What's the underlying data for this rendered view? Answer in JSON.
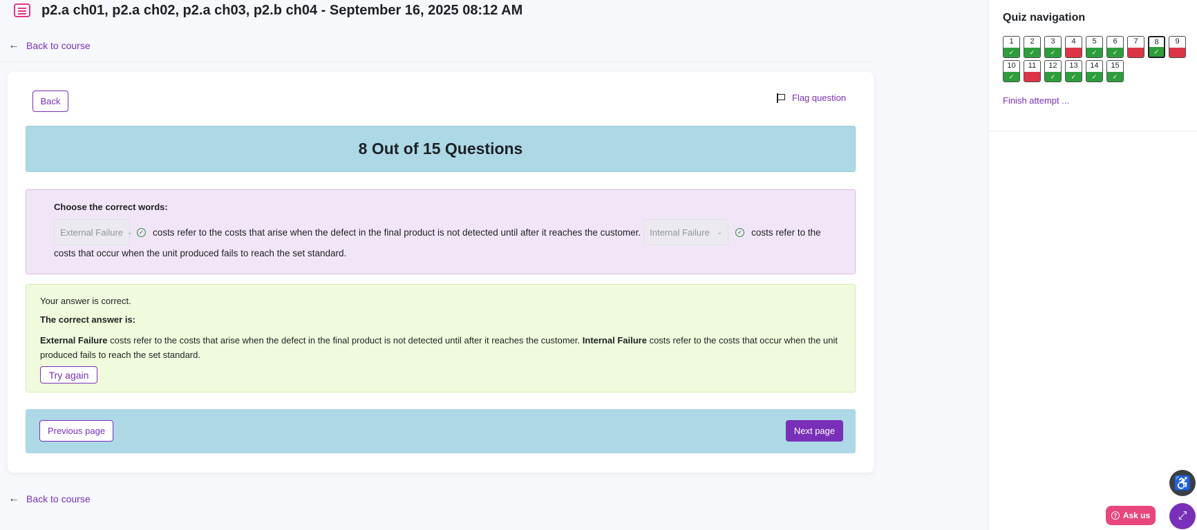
{
  "header": {
    "title": "p2.a ch01, p2.a ch02, p2.a ch03, p2.b ch04 - September 16, 2025 08:12 AM",
    "back_to_course": "Back to course"
  },
  "question": {
    "back_label": "Back",
    "flag_label": "Flag question",
    "progress_title": "8 Out of 15 Questions",
    "prompt": "Choose the correct words:",
    "dropdown1_value": "External Failure",
    "text_after_dropdown1": "costs refer to the costs that arise when the defect in the final product is not detected until after it reaches the customer.",
    "dropdown2_value": "Internal Failure",
    "text_after_dropdown2": "costs refer to the",
    "text_line2": "costs that occur when the unit produced fails to reach the set standard."
  },
  "feedback": {
    "status": "Your answer is correct.",
    "correct_heading": "The correct answer is:",
    "answer_term1": "External Failure",
    "answer_text1": " costs refer to the costs that arise when the defect in the final product is not detected until after it reaches the customer. ",
    "answer_term2": "Internal Failure",
    "answer_text2": " costs refer to the costs that occur when the unit produced fails to reach the set standard.",
    "try_again": "Try again"
  },
  "pagination": {
    "previous": "Previous page",
    "next": "Next page"
  },
  "quiz_navigation": {
    "title": "Quiz navigation",
    "current": 8,
    "questions": [
      {
        "num": "1",
        "state": "correct"
      },
      {
        "num": "2",
        "state": "correct"
      },
      {
        "num": "3",
        "state": "correct"
      },
      {
        "num": "4",
        "state": "incorrect"
      },
      {
        "num": "5",
        "state": "correct"
      },
      {
        "num": "6",
        "state": "correct"
      },
      {
        "num": "7",
        "state": "incorrect"
      },
      {
        "num": "8",
        "state": "correct"
      },
      {
        "num": "9",
        "state": "incorrect"
      },
      {
        "num": "10",
        "state": "correct"
      },
      {
        "num": "11",
        "state": "incorrect"
      },
      {
        "num": "12",
        "state": "correct"
      },
      {
        "num": "13",
        "state": "correct"
      },
      {
        "num": "14",
        "state": "correct"
      },
      {
        "num": "15",
        "state": "correct"
      }
    ],
    "finish_attempt": "Finish attempt ..."
  },
  "floating": {
    "ask_us": "Ask us",
    "icons": [
      "accessibility-icon",
      "help-circle-icon",
      "expand-icon"
    ]
  },
  "colors": {
    "accent": "#7a2fb8",
    "banner": "#add8e6",
    "question_bg": "#f1e6f7",
    "feedback_bg": "#effbdc",
    "correct": "#2e9e3c",
    "incorrect": "#dc3545"
  }
}
